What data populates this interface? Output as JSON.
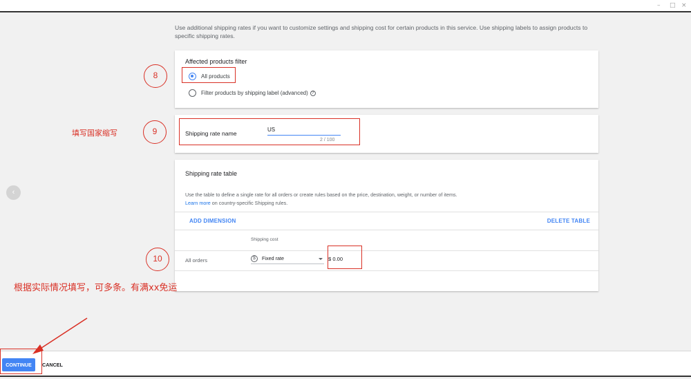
{
  "window": {
    "controls": [
      "–",
      "□",
      "×"
    ]
  },
  "intro_text": "Use additional shipping rates if you want to customize settings and shipping cost for certain products in this service. Use shipping labels to assign products to specific shipping rates.",
  "filter_card": {
    "title": "Affected products filter",
    "options": [
      {
        "label": "All products",
        "checked": true
      },
      {
        "label": "Filter products by shipping label (advanced)",
        "checked": false
      }
    ],
    "help_symbol": "?"
  },
  "name_card": {
    "label": "Shipping rate name",
    "value": "US",
    "counter": "2 / 100"
  },
  "table_card": {
    "title": "Shipping rate table",
    "description": "Use the table to define a single rate for all orders or create rules based on the price, destination, weight, or number of items.",
    "learn_more_link": "Learn more",
    "learn_more_suffix": " on country-specific Shipping rules.",
    "add_dimension": "ADD DIMENSION",
    "delete_table": "DELETE TABLE",
    "column_header": "Shipping cost",
    "row_label": "All orders",
    "rate_type": "Fixed rate",
    "rate_icon": "$",
    "cost_value": "$ 0.00"
  },
  "nav": {
    "back_symbol": "‹"
  },
  "footer": {
    "continue": "CONTINUE",
    "cancel": "CANCEL"
  },
  "annotations": {
    "step8": "8",
    "step9": "9",
    "step10": "10",
    "note9": "填写国家缩写",
    "note10": "根据实际情况填写，可多条。有满xx免运"
  },
  "colors": {
    "accent": "#4285f4",
    "annotation": "#d93025"
  }
}
